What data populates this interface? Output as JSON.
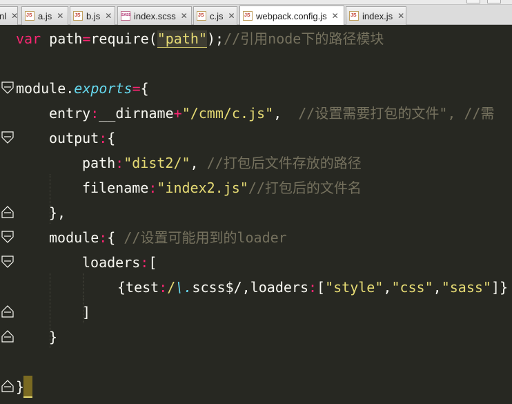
{
  "tabs": [
    {
      "label": "nl",
      "icon": "html-file-icon",
      "close": "✕"
    },
    {
      "label": "a.js",
      "icon": "js-file-icon",
      "close": "✕"
    },
    {
      "label": "b.js",
      "icon": "js-file-icon",
      "close": "✕"
    },
    {
      "label": "index.scss",
      "icon": "sass-file-icon",
      "close": "✕"
    },
    {
      "label": "c.js",
      "icon": "js-file-icon",
      "close": "✕"
    },
    {
      "label": "webpack.config.js",
      "icon": "js-file-icon",
      "close": "✕",
      "active": true
    },
    {
      "label": "index.js",
      "icon": "js-file-icon",
      "close": "✕"
    }
  ],
  "code": {
    "l1": {
      "kw": "var",
      "name": " path",
      "op": "=",
      "fn": "require(",
      "q1": "\"",
      "arg": "path",
      "q2": "\"",
      "rest": ");",
      "comment": "//引用node下的路径模块"
    },
    "l3": {
      "name": "module.",
      "prop": "exports",
      "op": "=",
      "brace": "{"
    },
    "l4": {
      "key": "entry",
      "colon": ":",
      "val": "__dirname",
      "op": "+",
      "str": "\"/cmm/c.js\"",
      "comma": ",  ",
      "comment": "//设置需要打包的文件\", //需"
    },
    "l5": {
      "key": "output",
      "colon": ":",
      "brace": "{"
    },
    "l6": {
      "key": "path",
      "colon": ":",
      "str": "\"dist2/\"",
      "comma": ", ",
      "comment": "//打包后文件存放的路径"
    },
    "l7": {
      "key": "filename",
      "colon": ":",
      "str": "\"index2.js\"",
      "comment": "//打包后的文件名"
    },
    "l8": {
      "text": "},"
    },
    "l9": {
      "key": "module",
      "colon": ":",
      "brace": "{ ",
      "comment": "//设置可能用到的loader"
    },
    "l10": {
      "key": "loaders",
      "colon": ":",
      "bracket": "["
    },
    "l11": {
      "open": "{test",
      "colon": ":",
      "re1": "/",
      "esc": "\\.",
      "re2": "scss$/",
      "comma": ",",
      "key2": "loaders",
      "colon2": ":",
      "lb": "[",
      "s1": "\"style\"",
      "c1": ",",
      "s2": "\"css\"",
      "c2": ",",
      "s3": "\"sass\"",
      "rb": "]}"
    },
    "l12": {
      "text": "]"
    },
    "l13": {
      "text": "}"
    },
    "l15": {
      "text": "}"
    }
  },
  "colors": {
    "background": "#272822",
    "keyword": "#f92672",
    "string": "#e6db74",
    "comment": "#75715e",
    "identifier": "#66d9ef"
  }
}
